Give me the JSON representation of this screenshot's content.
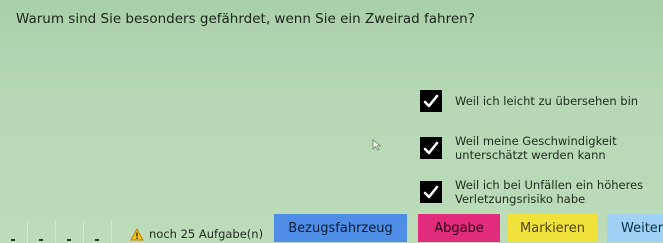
{
  "question": "Warum sind Sie besonders gefährdet, wenn Sie ein Zweirad fahren?",
  "answers": [
    {
      "text": "Weil ich leicht zu übersehen bin",
      "checked": true
    },
    {
      "text": "Weil meine Geschwindigkeit\nunterschätzt werden kann",
      "checked": true
    },
    {
      "text": "Weil ich bei Unfällen ein höheres\nVerletzungsrisiko habe",
      "checked": true
    }
  ],
  "footer": {
    "remaining": "noch 25 Aufgabe(n)",
    "warning_icon": "warning-triangle-icon",
    "buttons": {
      "bezugsfahrzeug": "Bezugsfahrzeug",
      "abgabe": "Abgabe",
      "markieren": "Markieren",
      "weiter": "Weiter"
    }
  },
  "colors": {
    "background": "#b5d8b3",
    "bezugsfahrzeug": "#4f8ee6",
    "abgabe": "#e12b7d",
    "markieren": "#f1e13b",
    "weiter": "#9fd2f5"
  }
}
